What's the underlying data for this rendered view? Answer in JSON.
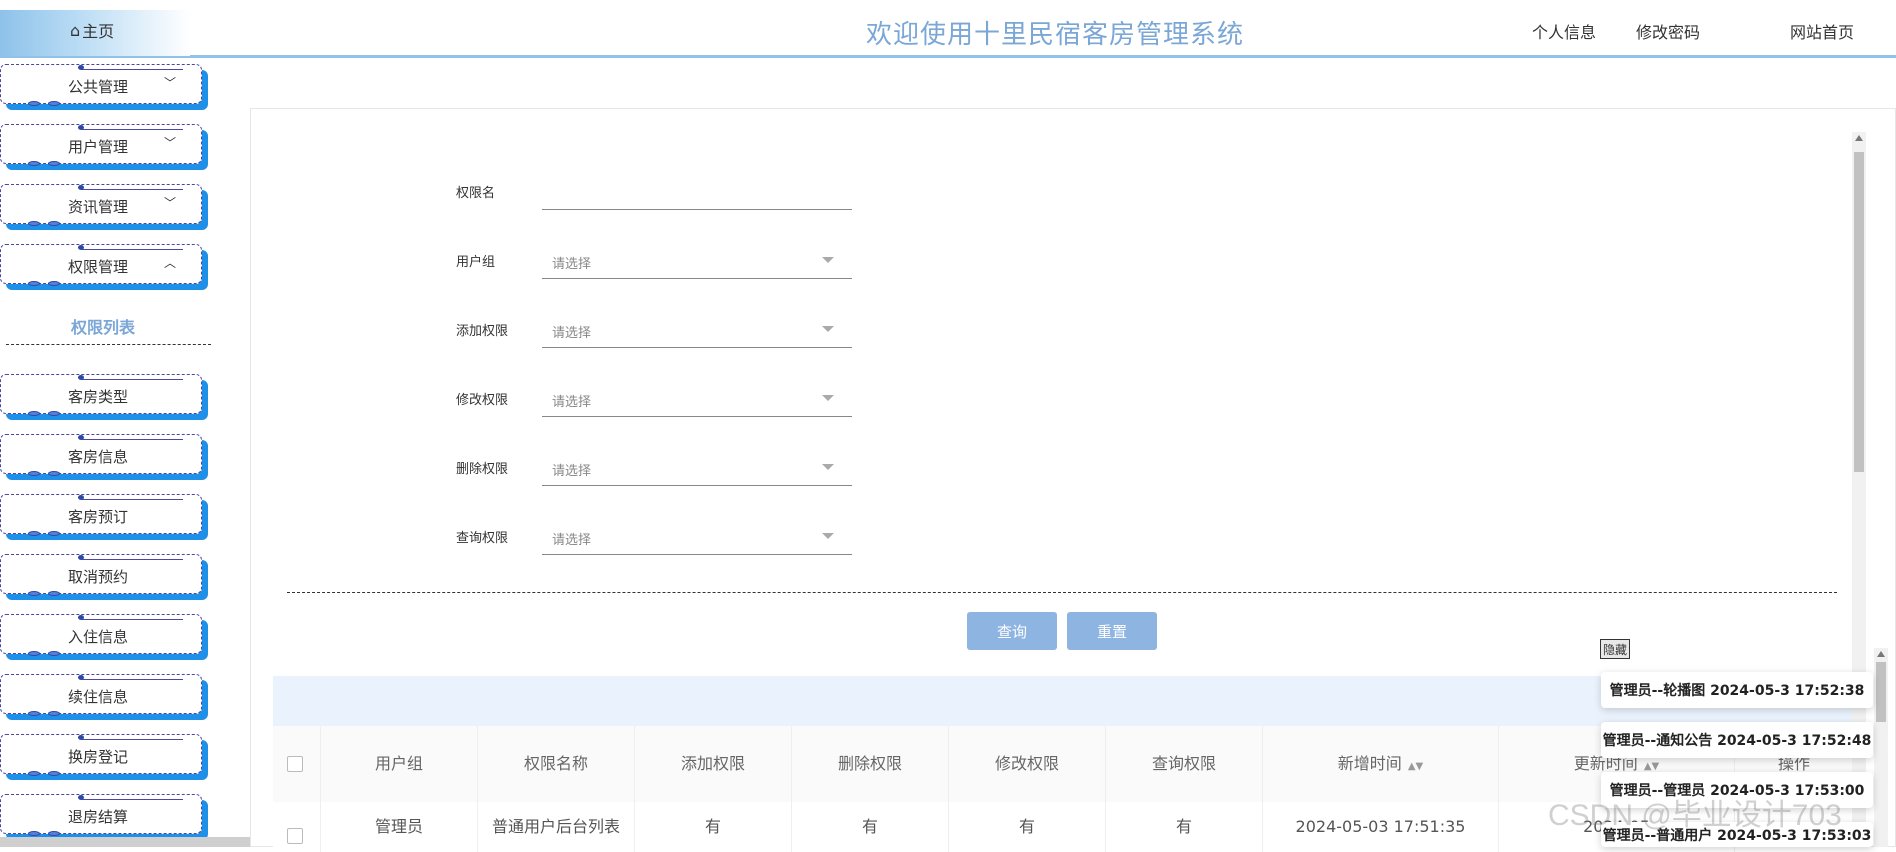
{
  "header": {
    "home": "主页",
    "home_icon": "home-icon",
    "title": "欢迎使用十里民宿客房管理系统",
    "profile": "个人信息",
    "change_password": "修改密码",
    "site_home": "网站首页"
  },
  "sidebar": {
    "groups": [
      {
        "label": "公共管理",
        "chevron": "chevron-down-icon"
      },
      {
        "label": "用户管理",
        "chevron": "chevron-down-icon"
      },
      {
        "label": "资讯管理",
        "chevron": "chevron-down-icon"
      },
      {
        "label": "权限管理",
        "chevron": "chevron-up-icon"
      }
    ],
    "submenu_active": "权限列表",
    "items": [
      "客房类型",
      "客房信息",
      "客房预订",
      "取消预约",
      "入住信息",
      "续住信息",
      "换房登记",
      "退房结算"
    ]
  },
  "search": {
    "permission_name_label": "权限名",
    "permission_name_value": "",
    "user_group_label": "用户组",
    "add_perm_label": "添加权限",
    "edit_perm_label": "修改权限",
    "delete_perm_label": "删除权限",
    "query_perm_label": "查询权限",
    "placeholder": "请选择",
    "query_button": "查询",
    "reset_button": "重置"
  },
  "table": {
    "headers": [
      "用户组",
      "权限名称",
      "添加权限",
      "删除权限",
      "修改权限",
      "查询权限",
      "新增时间",
      "更新时间",
      "操作"
    ],
    "rows": [
      [
        "管理员",
        "普通用户后台列表",
        "有",
        "有",
        "有",
        "有",
        "2024-05-03 17:51:35",
        "2024-05"
      ]
    ]
  },
  "notifications": {
    "hide_label": "隐藏",
    "items": [
      "管理员--轮播图 2024-05-3 17:52:38",
      "管理员--通知公告 2024-05-3 17:52:48",
      "管理员--管理员 2024-05-3 17:53:00",
      "管理员--普通用户 2024-05-3 17:53:03"
    ]
  },
  "watermark": "CSDN @毕业设计703",
  "colors": {
    "accent": "#7aa7d6",
    "button": "#8eb4e2",
    "menu_shadow": "#1e90e8",
    "menu_border": "#4a47a3"
  }
}
